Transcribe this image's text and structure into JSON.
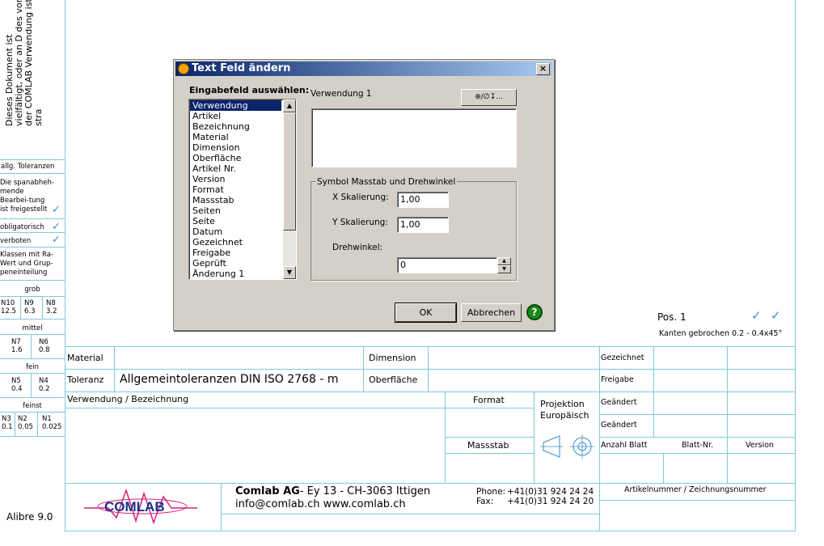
{
  "left_panel": {
    "rotated_notice": "Dieses Dokument ist vielfältigt, oder an D des von der COMLAB Verwendung ist stra",
    "allg_tol_title": "allg. Toleranzen",
    "spanab_text": "Die spanabheh-mende Bearbei-tung ist freigestellt",
    "obligatorisch": "obligatorisch",
    "verboten": "verboten",
    "klassen_text": "Klassen mit Ra-Wert und Grup-peneinteilung",
    "grob": "grob",
    "grob_vals": [
      [
        "N10",
        "12.5"
      ],
      [
        "N9",
        "6.3"
      ],
      [
        "N8",
        "3.2"
      ]
    ],
    "mittel": "mittel",
    "mittel_vals": [
      [
        "N7",
        "1.6"
      ],
      [
        "N6",
        "0.8"
      ]
    ],
    "fein": "fein",
    "fein_vals": [
      [
        "N5",
        "0.4"
      ],
      [
        "N4",
        "0.2"
      ]
    ],
    "feinst": "feinst",
    "feinst_vals": [
      [
        "N3",
        "0.1"
      ],
      [
        "N2",
        "0.05"
      ],
      [
        "N1",
        "0.025"
      ]
    ],
    "alibre": "Alibre 9.0"
  },
  "pos": {
    "label": "Pos. 1",
    "kanten": "Kanten gebrochen 0.2 - 0.4x45°"
  },
  "title_block": {
    "material": "Material",
    "dimension": "Dimension",
    "toleranz": "Toleranz",
    "toleranz_value": "Allgemeintoleranzen DIN ISO 2768 - m",
    "oberflaeche": "Oberfläche",
    "verwendung": "Verwendung / Bezeichnung",
    "format": "Format",
    "massstab": "Massstab",
    "projektion": "Projektion",
    "europaeisch": "Europäisch",
    "gezeichnet": "Gezeichnet",
    "freigabe": "Freigabe",
    "geaendert1": "Geändert",
    "geaendert2": "Geändert",
    "anzahl_blatt": "Anzahl Blatt",
    "blatt_nr": "Blatt-Nr.",
    "version": "Version",
    "artikelnummer": "Artikelnummer / Zeichnungsnummer",
    "company": "Comlab AG",
    "address": "- Ey 13 - CH-3063 Ittigen",
    "contact": "info@comlab.ch  www.comlab.ch",
    "phone_label": "Phone:",
    "phone": "+41(0)31 924 24 24",
    "fax_label": "Fax:",
    "fax": "+41(0)31 924 24 20",
    "logo_text": "COMLAB"
  },
  "dialog": {
    "title": "Text Feld ändern",
    "close": "×",
    "select_label": "Eingabefeld auswählen:",
    "items": [
      "Verwendung",
      "Artikel",
      "Bezeichnung",
      "Material",
      "Dimension",
      "Oberfläche",
      "Artikel Nr.",
      "Version",
      "Format",
      "Massstab",
      "Seiten",
      "Seite",
      "Datum",
      "Gezeichnet",
      "Freigabe",
      "Geprüft",
      "Änderung 1"
    ],
    "selected_index": 0,
    "field_label": "Verwendung 1",
    "symbol_button": "⊕∕∅↧...",
    "text_value": "",
    "group_title": "Symbol Masstab und Drehwinkel",
    "x_label": "X Skalierung:",
    "x_value": "1,00",
    "y_label": "Y Skalierung:",
    "y_value": "1,00",
    "dreh_label": "Drehwinkel:",
    "dreh_value": "0",
    "ok": "OK",
    "cancel": "Abbrechen",
    "help": "?"
  },
  "colors": {
    "border": "#7fc9d8",
    "titlebar_start": "#0a246a",
    "titlebar_end": "#a6caf0",
    "dialog_bg": "#d4d0c8",
    "help_green": "#1a8a1a",
    "check_blue": "#3b8ecb"
  }
}
